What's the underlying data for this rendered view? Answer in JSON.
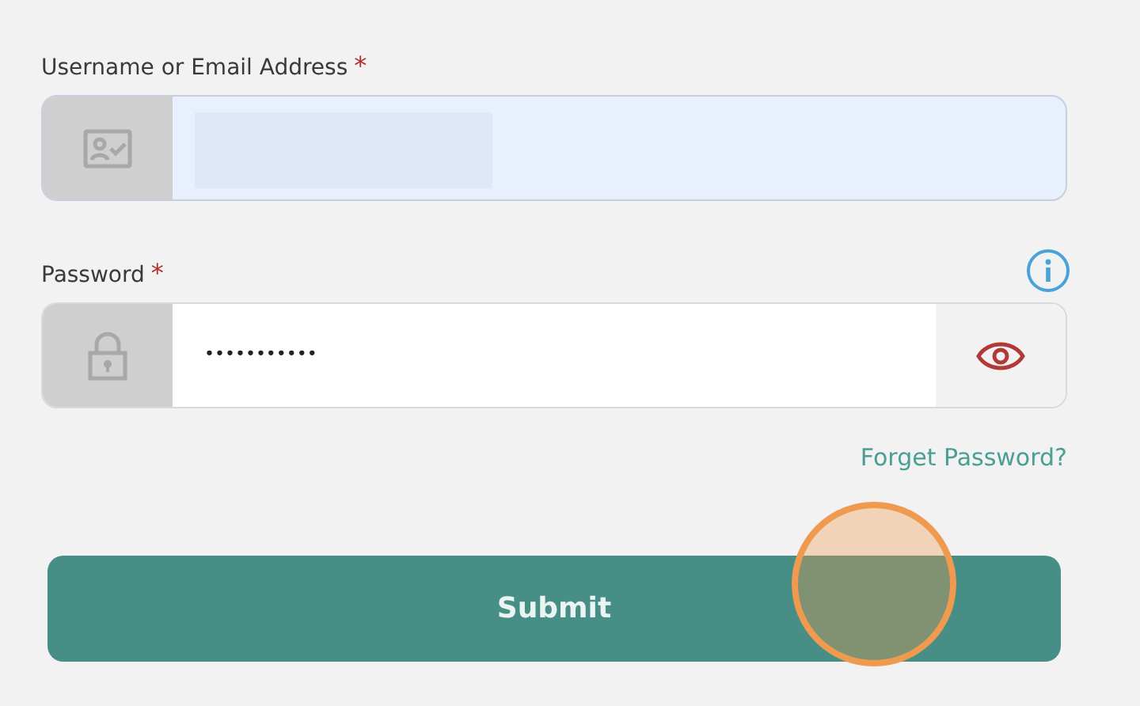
{
  "fields": [
    {
      "kind": "text",
      "label": "Username or Email Address",
      "required_mark": "*",
      "autofilled": true
    },
    {
      "kind": "password",
      "label": "Password",
      "required_mark": "*",
      "value": "•••••••••••",
      "autofilled": false
    }
  ],
  "forgot_link": "Forget Password?",
  "submit_button": "Submit",
  "click_marker": true
}
